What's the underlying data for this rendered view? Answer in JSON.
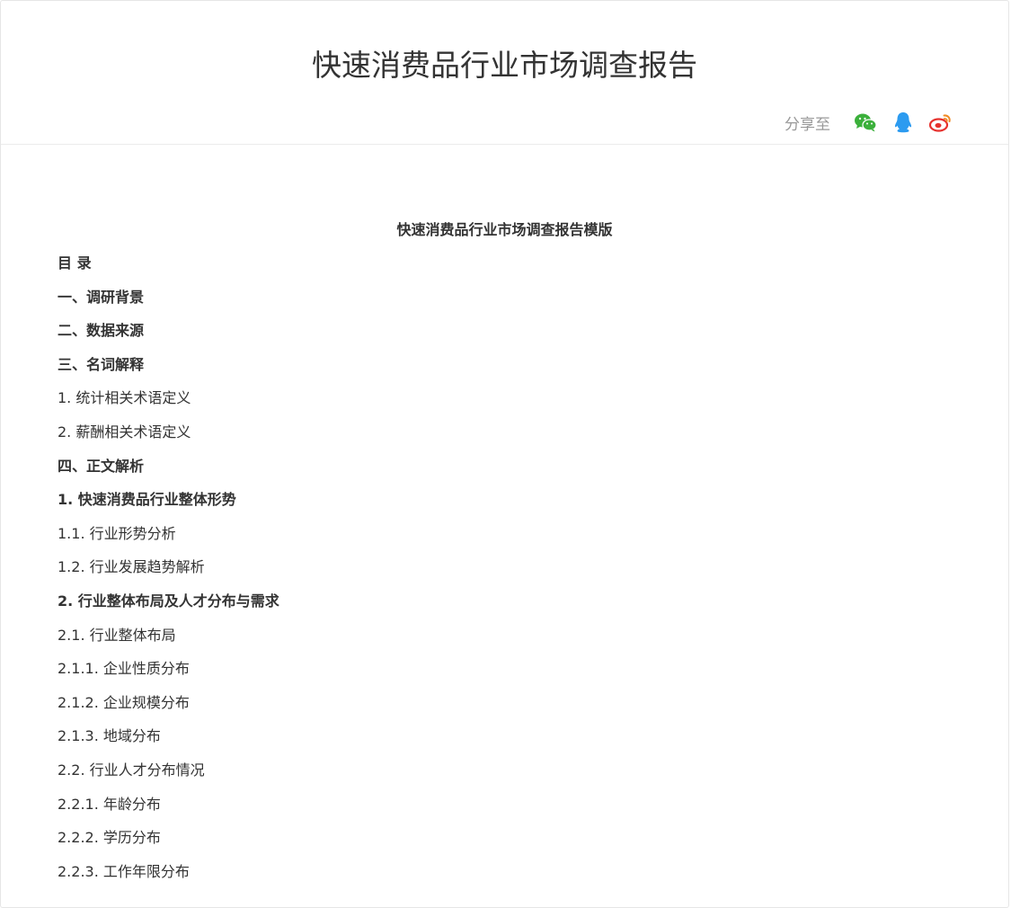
{
  "header": {
    "title": "快速消费品行业市场调查报告",
    "share_label": "分享至",
    "share_targets": [
      {
        "icon": "wechat-icon",
        "color": "#3bb03b"
      },
      {
        "icon": "qq-icon",
        "color": "#2c9bf0"
      },
      {
        "icon": "weibo-icon",
        "color": "#e6322e"
      }
    ]
  },
  "document": {
    "title": "快速消费品行业市场调查报告模版",
    "toc": [
      {
        "text": "目 录",
        "bold": true
      },
      {
        "text": "一、调研背景",
        "bold": true
      },
      {
        "text": "二、数据来源",
        "bold": true
      },
      {
        "text": "三、名词解释",
        "bold": true
      },
      {
        "text": "1. 统计相关术语定义",
        "bold": false
      },
      {
        "text": "2. 薪酬相关术语定义",
        "bold": false
      },
      {
        "text": "四、正文解析",
        "bold": true
      },
      {
        "text": "1. 快速消费品行业整体形势",
        "bold": true
      },
      {
        "text": "1.1. 行业形势分析",
        "bold": false
      },
      {
        "text": "1.2. 行业发展趋势解析",
        "bold": false
      },
      {
        "text": "2. 行业整体布局及人才分布与需求",
        "bold": true
      },
      {
        "text": "2.1. 行业整体布局",
        "bold": false
      },
      {
        "text": "2.1.1. 企业性质分布",
        "bold": false
      },
      {
        "text": "2.1.2. 企业规模分布",
        "bold": false
      },
      {
        "text": "2.1.3. 地域分布",
        "bold": false
      },
      {
        "text": "2.2. 行业人才分布情况",
        "bold": false
      },
      {
        "text": "2.2.1. 年龄分布",
        "bold": false
      },
      {
        "text": "2.2.2. 学历分布",
        "bold": false
      },
      {
        "text": "2.2.3. 工作年限分布",
        "bold": false
      }
    ]
  }
}
